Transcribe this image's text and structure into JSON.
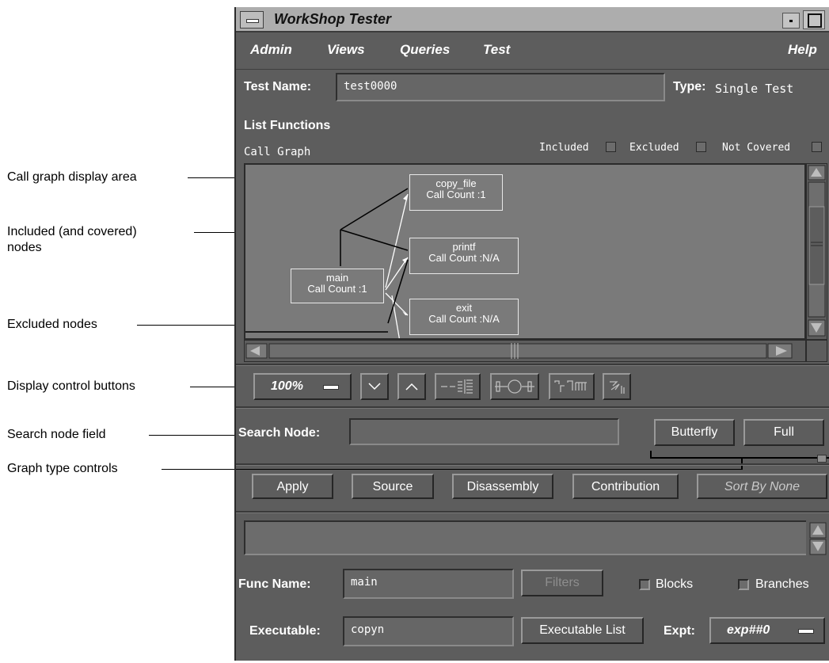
{
  "callouts": {
    "call_graph_area": "Call graph display area",
    "included_nodes_line1": "Included (and covered)",
    "included_nodes_line2": "nodes",
    "excluded_nodes": "Excluded nodes",
    "display_control_buttons": "Display control buttons",
    "search_node_field": "Search node field",
    "graph_type_controls": "Graph type controls"
  },
  "window": {
    "title": "WorkShop Tester"
  },
  "menubar": {
    "admin": "Admin",
    "views": "Views",
    "queries": "Queries",
    "test": "Test",
    "help": "Help"
  },
  "test": {
    "name_label": "Test Name:",
    "name_value": "test0000",
    "type_label": "Type:",
    "type_value": "Single Test"
  },
  "list_functions": {
    "heading": "List Functions",
    "view_label": "Call Graph",
    "legend_included": "Included",
    "legend_excluded": "Excluded",
    "legend_not_covered": "Not Covered"
  },
  "graph": {
    "nodes": [
      {
        "name": "main",
        "count": "Call Count :1"
      },
      {
        "name": "copy_file",
        "count": "Call Count :1"
      },
      {
        "name": "printf",
        "count": "Call Count :N/A"
      },
      {
        "name": "exit",
        "count": "Call Count :N/A"
      }
    ]
  },
  "display_controls": {
    "zoom": "100%"
  },
  "search": {
    "label": "Search Node:",
    "value": "",
    "butterfly": "Butterfly",
    "full": "Full"
  },
  "actions": {
    "apply": "Apply",
    "source": "Source",
    "disassembly": "Disassembly",
    "contribution": "Contribution",
    "sort": "Sort By None"
  },
  "func": {
    "label": "Func Name:",
    "value": "main",
    "filters": "Filters",
    "blocks": "Blocks",
    "branches": "Branches"
  },
  "executable": {
    "label": "Executable:",
    "value": "copyn",
    "list_button": "Executable List",
    "expt_label": "Expt:",
    "expt_value": "exp##0"
  }
}
